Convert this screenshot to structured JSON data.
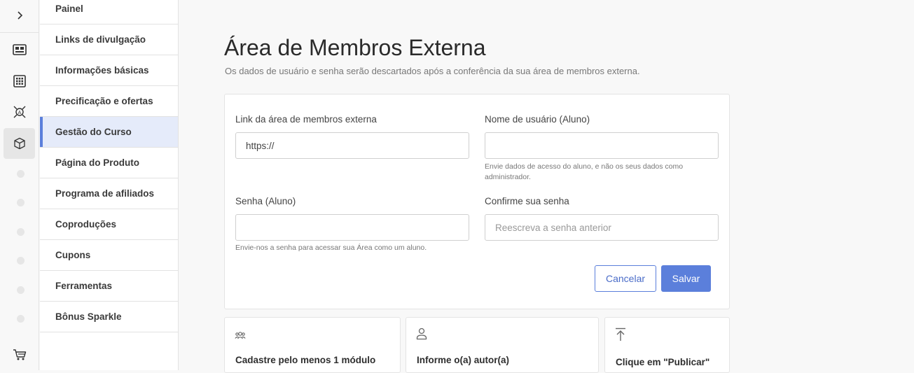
{
  "rail": {
    "icons": [
      "chevron-right-icon",
      "dashboard-icon",
      "grid-icon",
      "network-icon",
      "box-icon",
      "cart-icon"
    ],
    "active_index": 4
  },
  "menu": {
    "items": [
      {
        "label": "Painel"
      },
      {
        "label": "Links de divulgação"
      },
      {
        "label": "Informações básicas"
      },
      {
        "label": "Precificação e ofertas"
      },
      {
        "label": "Gestão do Curso",
        "active": true
      },
      {
        "label": "Página do Produto"
      },
      {
        "label": "Programa de afiliados"
      },
      {
        "label": "Coproduções"
      },
      {
        "label": "Cupons"
      },
      {
        "label": "Ferramentas"
      },
      {
        "label": "Bônus Sparkle"
      }
    ]
  },
  "page": {
    "title": "Área de Membros Externa",
    "subtitle": "Os dados de usuário e senha serão descartados após a conferência da sua área de membros externa."
  },
  "form": {
    "link_label": "Link da área de membros externa",
    "link_value": "https://",
    "username_label": "Nome de usuário (Aluno)",
    "username_value": "",
    "username_hint": "Envie dados de acesso do aluno, e não os seus dados como administrador.",
    "password_label": "Senha (Aluno)",
    "password_value": "",
    "password_hint": "Envie-nos a senha para acessar sua Área como um aluno.",
    "confirm_label": "Confirme sua senha",
    "confirm_placeholder": "Reescreva a senha anterior",
    "cancel_label": "Cancelar",
    "save_label": "Salvar"
  },
  "steps": [
    {
      "icon": "users-icon",
      "label": "Cadastre pelo menos 1 módulo"
    },
    {
      "icon": "user-icon",
      "label": "Informe o(a) autor(a)"
    },
    {
      "icon": "upload-icon",
      "label": "Clique em \"Publicar\""
    }
  ],
  "colors": {
    "accent": "#5b7fdb",
    "active_menu_bg": "#e5ebfa"
  }
}
